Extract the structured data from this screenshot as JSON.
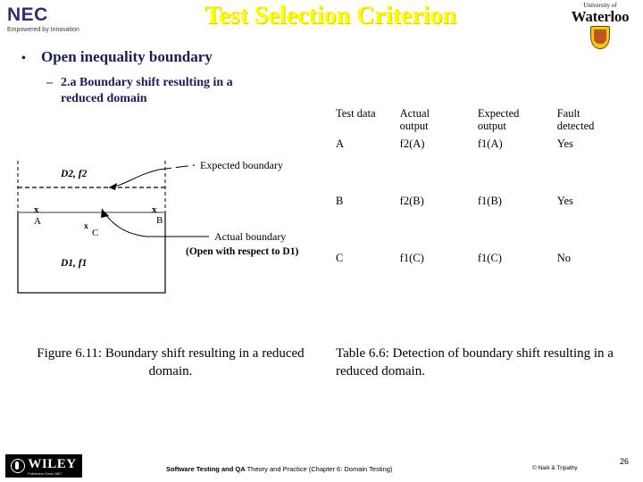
{
  "header": {
    "title": "Test Selection Criterion",
    "nec_logo": {
      "word": "NEC",
      "tagline": "Empowered by Innovation"
    },
    "waterloo_logo": {
      "line1": "University of",
      "line2": "Waterloo"
    },
    "title_color": "#ffff00"
  },
  "bullets": {
    "level1": "Open inequality boundary",
    "level1_marker": "•",
    "level2_marker": "–",
    "level2_line1": "2.a Boundary shift resulting in a",
    "level2_line2": "reduced domain",
    "text_color": "#1b1b5e"
  },
  "figure": {
    "region_upper_label": "D2,  f2",
    "region_lower_label": "D1,  f1",
    "point_a": "A",
    "point_b": "B",
    "point_c": "C",
    "marker_glyph": "x",
    "annotation_expected": "Expected boundary",
    "annotation_actual": "Actual boundary",
    "annotation_actual_sub": "(Open with respect to D1)",
    "caption_line1": "Figure 6.11: Boundary shift resulting in a",
    "caption_line2": "reduced domain."
  },
  "table": {
    "headers": [
      {
        "line1": "Test data",
        "line2": ""
      },
      {
        "line1": "Actual",
        "line2": "output"
      },
      {
        "line1": "Expected",
        "line2": "output"
      },
      {
        "line1": "Fault",
        "line2": "detected"
      }
    ],
    "rows": [
      {
        "test_data": "A",
        "actual_output": "f2(A)",
        "expected_output": "f1(A)",
        "fault_detected": "Yes"
      },
      {
        "test_data": "B",
        "actual_output": "f2(B)",
        "expected_output": "f1(B)",
        "fault_detected": "Yes"
      },
      {
        "test_data": "C",
        "actual_output": "f1(C)",
        "expected_output": "f1(C)",
        "fault_detected": "No"
      }
    ],
    "caption_line1": "Table 6.6: Detection of boundary",
    "caption_line2": "shift resulting in a reduced domain."
  },
  "footer": {
    "wiley_word": "WILEY",
    "wiley_sub": "Publishers Since 1807",
    "book_title_bold": "Software Testing and QA",
    "book_title_rest": " Theory and Practice (Chapter 6: Domain Testing)",
    "copyright": "© Naik & Tripathy",
    "page_number": "26"
  }
}
